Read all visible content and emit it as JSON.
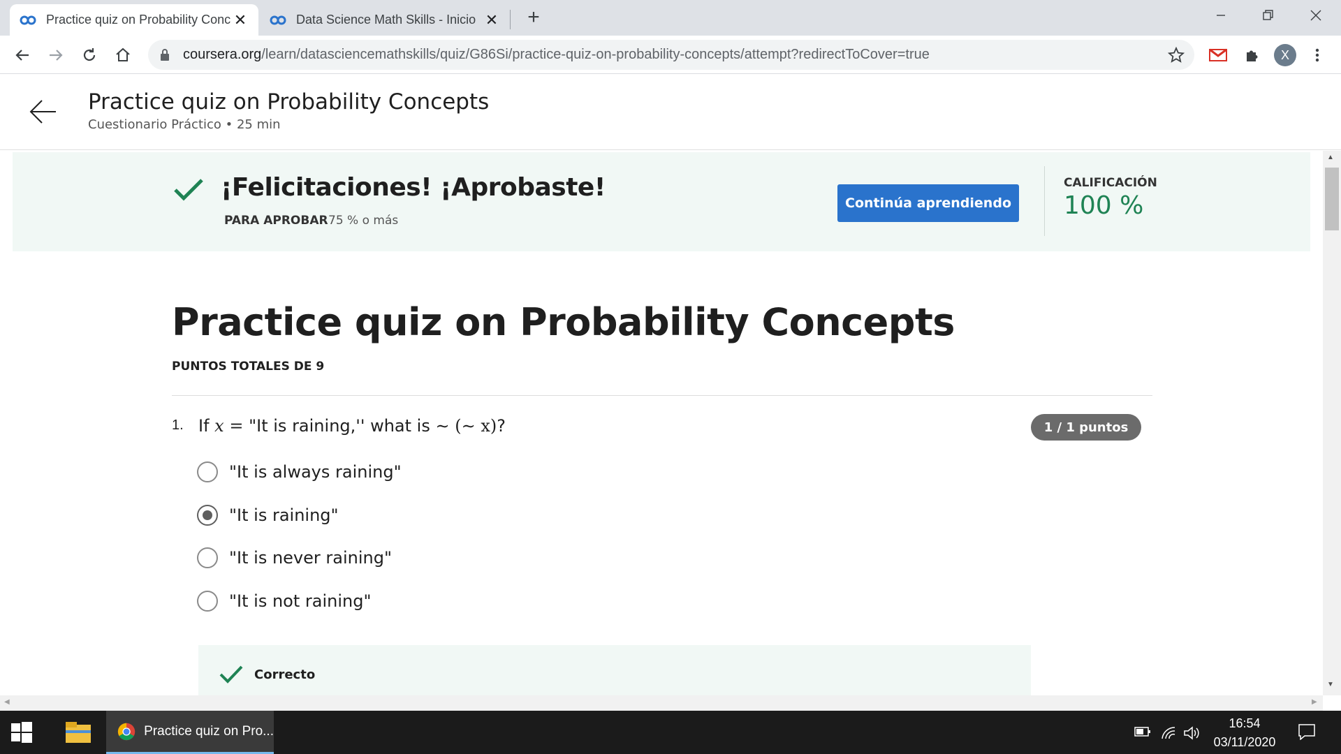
{
  "browser": {
    "tabs": [
      {
        "title": "Practice quiz on Probability Conc",
        "active": true
      },
      {
        "title": "Data Science Math Skills - Inicio",
        "active": false
      }
    ],
    "new_tab_label": "+",
    "url_host": "coursera.org",
    "url_path": "/learn/datasciencemathskills/quiz/G86Si/practice-quiz-on-probability-concepts/attempt?redirectToCover=true",
    "profile_initial": "X"
  },
  "header": {
    "title": "Practice quiz on Probability Concepts",
    "subtitle": "Cuestionario Práctico • 25 min"
  },
  "banner": {
    "title": "¡Felicitaciones! ¡Aprobaste!",
    "pass_label": "PARA APROBAR",
    "pass_value": "75 % o más",
    "continue_label": "Continúa aprendiendo",
    "grade_label": "CALIFICACIÓN",
    "grade_value": "100 %"
  },
  "quiz": {
    "title": "Practice quiz on Probability Concepts",
    "total_points": "PUNTOS TOTALES DE 9",
    "question": {
      "number": "1.",
      "text_prefix": "If",
      "var": "x",
      "text_mid": "\"It is raining,'' what is",
      "expr": "∼ (∼ x)",
      "text_suffix": "?",
      "points": "1 / 1 puntos",
      "options": [
        {
          "label": "\"It is always raining\"",
          "selected": false
        },
        {
          "label": "\"It is raining\"",
          "selected": true
        },
        {
          "label": "\"It is never raining\"",
          "selected": false
        },
        {
          "label": "\"It is not raining\"",
          "selected": false
        }
      ],
      "feedback": "Correcto"
    }
  },
  "taskbar": {
    "chrome_label": "Practice quiz on Pro...",
    "time": "16:54",
    "date": "03/11/2020"
  },
  "colors": {
    "accent_blue": "#2a73cc",
    "success_green": "#1f8354",
    "banner_bg": "#f1f8f5"
  }
}
